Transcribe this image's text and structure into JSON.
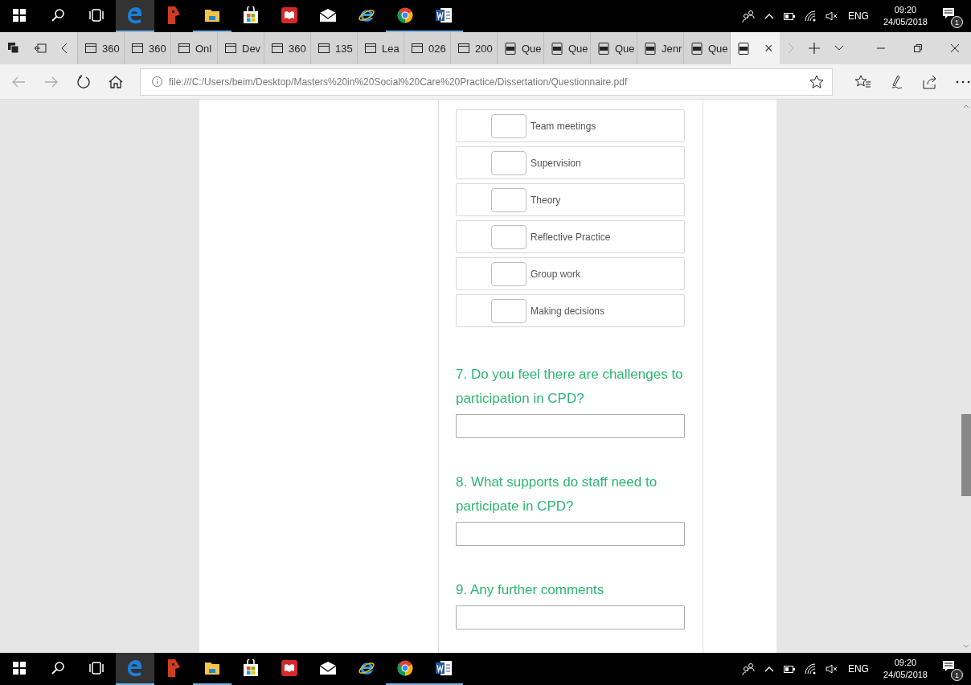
{
  "taskbar_top": {
    "apps": [
      {
        "kind": "start",
        "running": false,
        "active": false
      },
      {
        "kind": "search",
        "running": false,
        "active": false
      },
      {
        "kind": "taskview",
        "running": false,
        "active": false
      },
      {
        "kind": "edge",
        "running": true,
        "active": true
      },
      {
        "kind": "redapp",
        "running": false,
        "active": false
      },
      {
        "kind": "folder",
        "running": true,
        "active": false
      },
      {
        "kind": "store",
        "running": false,
        "active": false
      },
      {
        "kind": "book",
        "running": false,
        "active": false
      },
      {
        "kind": "mail",
        "running": false,
        "active": false
      },
      {
        "kind": "ie",
        "running": false,
        "active": false
      },
      {
        "kind": "chrome",
        "running": true,
        "active": false
      },
      {
        "kind": "word",
        "running": true,
        "active": false
      }
    ],
    "language": "ENG",
    "time": "09:20",
    "date": "24/05/2018",
    "notifications": "1"
  },
  "tabs": [
    {
      "label": "360",
      "kind": "page",
      "selected": false
    },
    {
      "label": "360",
      "kind": "page",
      "selected": false
    },
    {
      "label": "Onl",
      "kind": "page",
      "selected": false
    },
    {
      "label": "Dev",
      "kind": "page",
      "selected": false
    },
    {
      "label": "360",
      "kind": "page",
      "selected": false
    },
    {
      "label": "135",
      "kind": "page",
      "selected": false
    },
    {
      "label": "Lea",
      "kind": "page",
      "selected": false
    },
    {
      "label": "026",
      "kind": "page",
      "selected": false
    },
    {
      "label": "200",
      "kind": "page",
      "selected": false
    },
    {
      "label": "Que",
      "kind": "pdf",
      "selected": false
    },
    {
      "label": "Que",
      "kind": "pdf",
      "selected": false
    },
    {
      "label": "Que",
      "kind": "pdf",
      "selected": false
    },
    {
      "label": "Jenr",
      "kind": "pdf",
      "selected": false
    },
    {
      "label": "Que",
      "kind": "pdf",
      "selected": false
    },
    {
      "kind": "pdf",
      "selected": true
    }
  ],
  "close_glyph": "×",
  "address": "file:///C:/Users/beim/Desktop/Masters%20in%20Social%20Care%20Practice/Dissertation/Questionnaire.pdf",
  "options": [
    {
      "label": "Team meetings",
      "checked": false
    },
    {
      "label": "Supervision",
      "checked": false
    },
    {
      "label": "Theory",
      "checked": false
    },
    {
      "label": "Reflective Practice",
      "checked": false
    },
    {
      "label": "Group work",
      "checked": false
    },
    {
      "label": "Making decisions",
      "checked": false
    }
  ],
  "questions": [
    {
      "text": "7. Do you feel there are challenges to participation in CPD?"
    },
    {
      "text": "8. What supports do staff need to participate in CPD?"
    },
    {
      "text": "9. Any further comments"
    }
  ],
  "taskbar_bottom": {
    "apps": [
      {
        "kind": "start",
        "running": false,
        "active": false
      },
      {
        "kind": "search",
        "running": false,
        "active": false
      },
      {
        "kind": "taskview",
        "running": false,
        "active": false
      },
      {
        "kind": "edge",
        "running": true,
        "active": true
      },
      {
        "kind": "redapp",
        "running": false,
        "active": false
      },
      {
        "kind": "folder",
        "running": true,
        "active": false
      },
      {
        "kind": "store",
        "running": false,
        "active": false
      },
      {
        "kind": "book",
        "running": false,
        "active": false
      },
      {
        "kind": "mail",
        "running": false,
        "active": false
      },
      {
        "kind": "ie",
        "running": false,
        "active": false
      },
      {
        "kind": "chrome",
        "running": true,
        "active": false
      },
      {
        "kind": "word",
        "running": true,
        "active": false
      }
    ],
    "language": "ENG",
    "time": "09:20",
    "date": "24/05/2018",
    "notifications": "1"
  }
}
